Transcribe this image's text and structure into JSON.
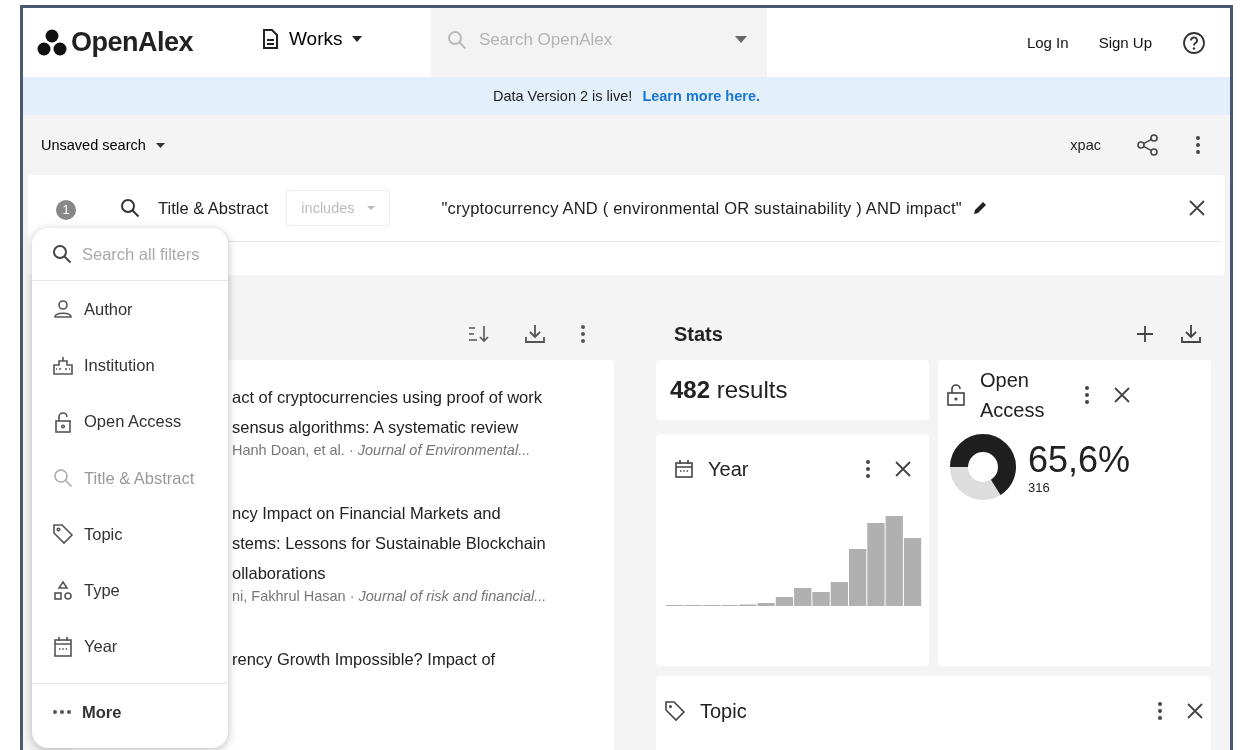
{
  "header": {
    "logo": "OpenAlex",
    "entity_menu": "Works",
    "search": {
      "placeholder": "Search OpenAlex"
    },
    "links": [
      "Log In",
      "Sign Up"
    ]
  },
  "banner": {
    "text": "Data Version 2 is live!",
    "link": "Learn more here."
  },
  "search_bar": {
    "name": "Unsaved search",
    "label": "xpac"
  },
  "filter": {
    "number": "1",
    "field": "Title & Abstract",
    "operator": "includes",
    "query": "\"cryptocurrency AND ( environmental OR sustainability ) AND impact\""
  },
  "filter_menu": {
    "search": {
      "placeholder": "Search all filters"
    },
    "items": [
      {
        "label": "Author",
        "kind": "filter",
        "disabled": false
      },
      {
        "label": "Institution",
        "kind": "filter",
        "disabled": false
      },
      {
        "label": "Open Access",
        "kind": "filter",
        "disabled": false
      },
      {
        "label": "Title & Abstract",
        "kind": "filter",
        "disabled": true
      },
      {
        "label": "Topic",
        "kind": "filter",
        "disabled": false
      },
      {
        "label": "Type",
        "kind": "filter",
        "disabled": false
      },
      {
        "label": "Year",
        "kind": "filter",
        "disabled": false
      },
      {
        "label": "More",
        "kind": "more",
        "disabled": false
      }
    ]
  },
  "results": [
    {
      "title_lines": [
        "act of cryptocurrencies using proof of work",
        "sensus algorithms: A systematic review"
      ],
      "meta": "Hanh Doan, et al. · *Journal of Environmental...*"
    },
    {
      "title_lines": [
        "ncy Impact on Financial Markets and",
        "stems: Lessons for Sustainable Blockchain",
        "ollaborations"
      ],
      "meta": "ni, Fakhrul Hasan · *Journal of risk and financial...*"
    },
    {
      "title_lines": [
        "rency Growth Impossible? Impact of"
      ]
    }
  ],
  "stats": {
    "title": "Stats",
    "count": "482",
    "count_label": "results",
    "cards": [
      {
        "kind": "year",
        "title": "Year"
      },
      {
        "kind": "oa",
        "title": "Open Access",
        "percent": "65,6%",
        "count": "316"
      },
      {
        "kind": "topic",
        "title": "Topic"
      }
    ]
  }
}
